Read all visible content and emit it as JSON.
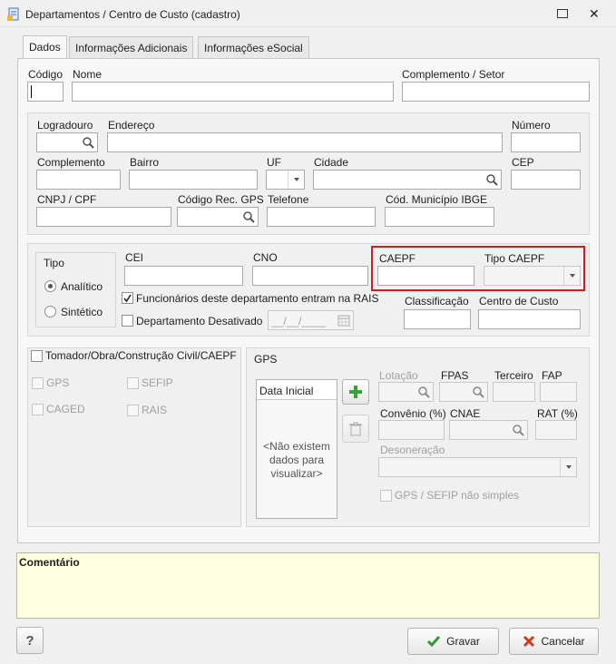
{
  "window": {
    "title": "Departamentos / Centro de Custo (cadastro)"
  },
  "tabs": [
    "Dados",
    "Informações Adicionais",
    "Informações eSocial"
  ],
  "top_fields": {
    "codigo": "Código",
    "nome": "Nome",
    "complemento_setor": "Complemento / Setor"
  },
  "address": {
    "logradouro": "Logradouro",
    "endereco": "Endereço",
    "numero": "Número",
    "complemento": "Complemento",
    "bairro": "Bairro",
    "uf": "UF",
    "cidade": "Cidade",
    "cep": "CEP",
    "cnpj_cpf": "CNPJ / CPF",
    "codigo_rec_gps": "Código Rec. GPS",
    "telefone": "Telefone",
    "cod_municipio_ibge": "Cód. Município IBGE"
  },
  "tipo": {
    "title": "Tipo",
    "analitico": "Analítico",
    "sintetico": "Sintético",
    "selected": "Analítico"
  },
  "middle": {
    "cei": "CEI",
    "cno": "CNO",
    "caepf": "CAEPF",
    "tipo_caepf": "Tipo CAEPF",
    "funcionarios_rais": "Funcionários deste departamento entram na RAIS",
    "departamento_desativado": "Departamento Desativado",
    "date_placeholder": "__/__/____",
    "classificacao": "Classificação",
    "centro_de_custo": "Centro de Custo"
  },
  "tomador": {
    "title": "Tomador/Obra/Construção Civil/CAEPF",
    "gps": "GPS",
    "sefip": "SEFIP",
    "caged": "CAGED",
    "rais": "RAIS"
  },
  "gps": {
    "title": "GPS",
    "data_inicial": "Data Inicial",
    "empty": "<Não existem dados para visualizar>",
    "lotacao": "Lotação",
    "fpas": "FPAS",
    "terceiro": "Terceiro",
    "fap": "FAP",
    "convenio": "Convênio (%)",
    "cnae": "CNAE",
    "rat": "RAT (%)",
    "desoneracao": "Desoneração",
    "nao_simples": "GPS / SEFIP não simples"
  },
  "comentario": "Comentário",
  "buttons": {
    "help": "?",
    "gravar": "Gravar",
    "cancelar": "Cancelar"
  },
  "colors": {
    "highlight": "#d9191f",
    "comment_bg": "#ffffe1",
    "check": "#2f9a2f",
    "cancel": "#d23a1a"
  }
}
